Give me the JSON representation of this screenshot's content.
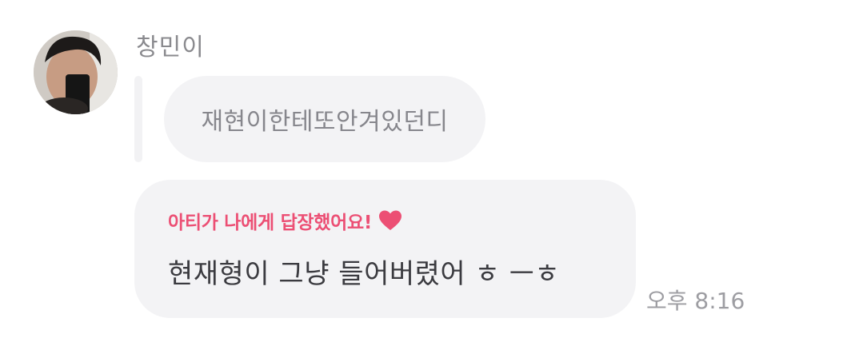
{
  "sender": {
    "name": "창민이",
    "avatar_icon": "profile-photo"
  },
  "quoted_message": {
    "text": "재현이한테또안겨있던디"
  },
  "reply": {
    "label": "아티가 나에게 답장했어요!",
    "label_icon": "heart-icon",
    "label_color": "#ec4f74",
    "text": "현재형이 그냥 들어버렸어 ㅎ ㅡㅎ"
  },
  "timestamp": "오후 8:16",
  "colors": {
    "bubble": "#f3f3f5",
    "name": "#8a8a8e",
    "timestamp": "#9d9da2"
  }
}
